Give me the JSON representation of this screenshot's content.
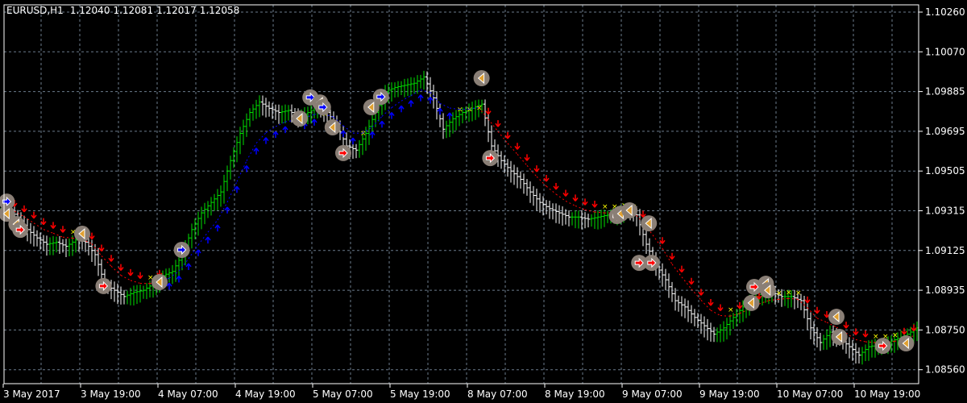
{
  "header": {
    "symbol": "EURUSD,H1",
    "open": "1.12040",
    "high": "1.12081",
    "low": "1.12017",
    "close": "1.12058"
  },
  "chart_data": {
    "type": "bar",
    "title": "EURUSD,H1",
    "ylim": [
      1.0849,
      1.10335
    ],
    "price_ticks": [
      "1.10260",
      "1.10070",
      "1.09885",
      "1.09695",
      "1.09505",
      "1.09315",
      "1.09125",
      "1.08935",
      "1.08750",
      "1.08560"
    ],
    "time_labels": [
      "3 May 2017",
      "3 May 19:00",
      "4 May 07:00",
      "4 May 19:00",
      "5 May 07:00",
      "5 May 19:00",
      "8 May 07:00",
      "8 May 19:00",
      "9 May 07:00",
      "9 May 19:00",
      "10 May 07:00",
      "10 May 19:00"
    ],
    "grid": true,
    "bar_step_hours": 3,
    "closes": [
      1.0932,
      1.0928,
      1.0922,
      1.0918,
      1.0915,
      1.0916,
      1.0914,
      1.0917,
      1.0916,
      1.091,
      1.0896,
      1.0893,
      1.089,
      1.0892,
      1.0893,
      1.0896,
      1.09,
      1.0902,
      1.091,
      1.0922,
      1.093,
      1.0935,
      1.094,
      1.0955,
      1.0968,
      1.0978,
      1.0983,
      1.098,
      1.0978,
      1.0979,
      1.0976,
      1.0978,
      1.0981,
      1.0978,
      1.0972,
      1.0962,
      1.096,
      1.0968,
      1.0978,
      1.0988,
      1.099,
      1.0991,
      1.0992,
      1.0995,
      1.0985,
      1.097,
      1.0975,
      1.0978,
      1.098,
      1.0982,
      1.0962,
      1.0955,
      1.095,
      1.0946,
      1.094,
      1.0935,
      1.0932,
      1.093,
      1.0928,
      1.0928,
      1.0927,
      1.0928,
      1.0929,
      1.093,
      1.0932,
      1.0929,
      1.0915,
      1.0905,
      1.0898,
      1.0888,
      1.0885,
      1.088,
      1.0876,
      1.0872,
      1.0875,
      1.088,
      1.0885,
      1.0889,
      1.0892,
      1.0892,
      1.089,
      1.089,
      1.0888,
      1.0875,
      1.0868,
      1.0873,
      1.087,
      1.0866,
      1.0862,
      1.0866,
      1.0867,
      1.0868,
      1.087,
      1.0872,
      1.0875
    ],
    "up_trend_ranges": [
      [
        17,
        49
      ]
    ],
    "signals": [
      {
        "bar": 0.2,
        "price": 1.09354,
        "kind": "buy"
      },
      {
        "bar": 0.2,
        "price": 1.09296,
        "kind": "exit"
      },
      {
        "bar": 1.2,
        "price": 1.09246,
        "kind": "exit"
      },
      {
        "bar": 1.6,
        "price": 1.09219,
        "kind": "sell"
      },
      {
        "bar": 8.0,
        "price": 1.092,
        "kind": "exit"
      },
      {
        "bar": 10.2,
        "price": 1.0895,
        "kind": "sell"
      },
      {
        "bar": 16.0,
        "price": 1.08969,
        "kind": "exit"
      },
      {
        "bar": 18.3,
        "price": 1.09123,
        "kind": "buy"
      },
      {
        "bar": 30.5,
        "price": 1.09751,
        "kind": "exit"
      },
      {
        "bar": 31.6,
        "price": 1.09852,
        "kind": "buy"
      },
      {
        "bar": 32.6,
        "price": 1.09828,
        "kind": "exit"
      },
      {
        "bar": 32.9,
        "price": 1.09805,
        "kind": "buy"
      },
      {
        "bar": 33.9,
        "price": 1.09709,
        "kind": "exit"
      },
      {
        "bar": 35.0,
        "price": 1.09586,
        "kind": "sell"
      },
      {
        "bar": 37.9,
        "price": 1.09805,
        "kind": "exit"
      },
      {
        "bar": 38.9,
        "price": 1.09855,
        "kind": "buy"
      },
      {
        "bar": 49.3,
        "price": 1.09944,
        "kind": "exit"
      },
      {
        "bar": 50.2,
        "price": 1.09562,
        "kind": "sell"
      },
      {
        "bar": 63.3,
        "price": 1.09285,
        "kind": "sell"
      },
      {
        "bar": 63.7,
        "price": 1.09296,
        "kind": "exit"
      },
      {
        "bar": 64.6,
        "price": 1.09312,
        "kind": "exit"
      },
      {
        "bar": 66.6,
        "price": 1.0925,
        "kind": "exit"
      },
      {
        "bar": 65.6,
        "price": 1.09061,
        "kind": "sell"
      },
      {
        "bar": 66.9,
        "price": 1.09061,
        "kind": "sell"
      },
      {
        "bar": 77.2,
        "price": 1.08869,
        "kind": "exit"
      },
      {
        "bar": 77.5,
        "price": 1.08946,
        "kind": "sell"
      },
      {
        "bar": 78.7,
        "price": 1.08961,
        "kind": "exit"
      },
      {
        "bar": 78.9,
        "price": 1.0893,
        "kind": "exit"
      },
      {
        "bar": 86.0,
        "price": 1.08803,
        "kind": "exit"
      },
      {
        "bar": 86.3,
        "price": 1.08707,
        "kind": "exit"
      },
      {
        "bar": 90.8,
        "price": 1.08664,
        "kind": "sell"
      },
      {
        "bar": 93.2,
        "price": 1.08676,
        "kind": "exit"
      }
    ],
    "colors": {
      "bull": "#00e000",
      "bear": "#ffffff",
      "up": "#0000ff",
      "down": "#ff0000",
      "cross": "#ffff00",
      "grid": "#6b7b8c",
      "marker": "#8a7f76",
      "exit": "#e0a030"
    }
  }
}
